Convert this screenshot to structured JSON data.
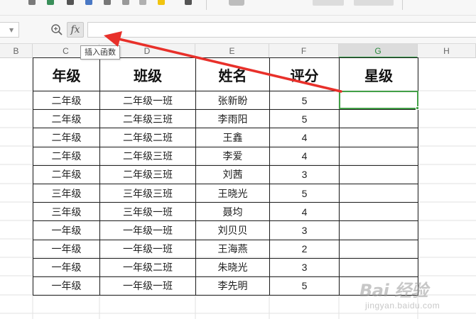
{
  "formula_bar": {
    "fx_label": "fx",
    "formula_value": "",
    "tooltip": "插入函数"
  },
  "column_headers": [
    "B",
    "C",
    "D",
    "E",
    "F",
    "G",
    "H"
  ],
  "selected_column": "G",
  "table": {
    "headers": [
      "年级",
      "班级",
      "姓名",
      "评分",
      "星级"
    ],
    "rows": [
      [
        "二年级",
        "二年级一班",
        "张新盼",
        "5",
        ""
      ],
      [
        "二年级",
        "二年级三班",
        "李雨阳",
        "5",
        ""
      ],
      [
        "二年级",
        "二年级二班",
        "王鑫",
        "4",
        ""
      ],
      [
        "二年级",
        "二年级三班",
        "李爱",
        "4",
        ""
      ],
      [
        "二年级",
        "二年级三班",
        "刘茜",
        "3",
        ""
      ],
      [
        "三年级",
        "三年级三班",
        "王晓光",
        "5",
        ""
      ],
      [
        "三年级",
        "三年级一班",
        "聂均",
        "4",
        ""
      ],
      [
        "一年级",
        "一年级一班",
        "刘贝贝",
        "3",
        ""
      ],
      [
        "一年级",
        "一年级一班",
        "王海燕",
        "2",
        ""
      ],
      [
        "一年级",
        "一年级二班",
        "朱晓光",
        "3",
        ""
      ],
      [
        "一年级",
        "一年级一班",
        "李先明",
        "5",
        ""
      ]
    ]
  },
  "colors": {
    "selection": "#43a047",
    "arrow": "#e8302a"
  },
  "watermark": {
    "main": "Bai 经验",
    "sub": "jingyan.baidu.com"
  }
}
